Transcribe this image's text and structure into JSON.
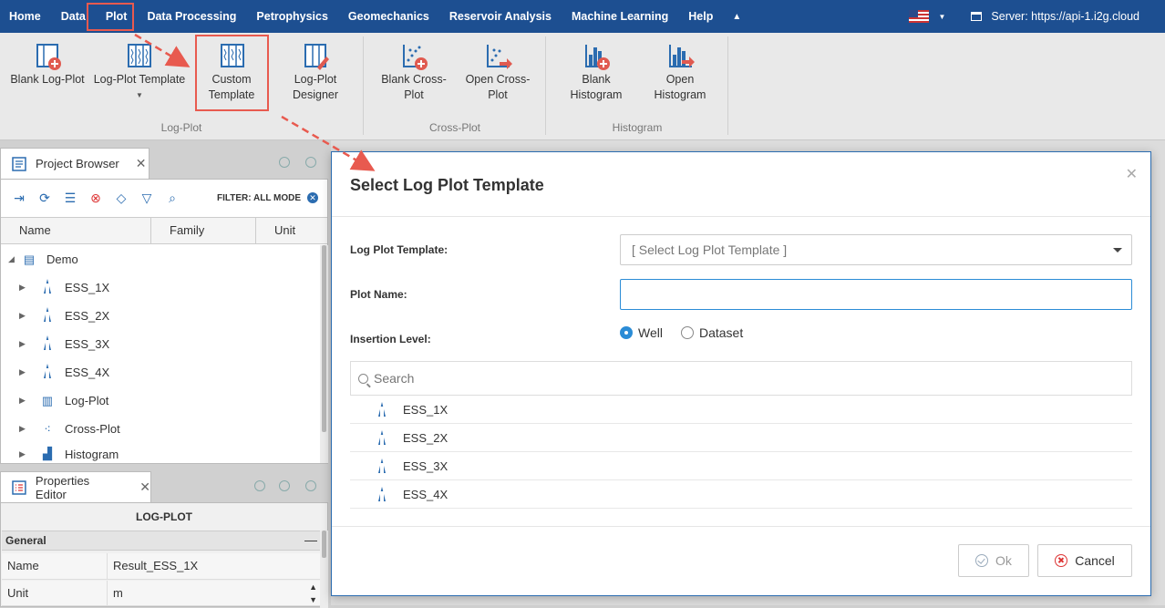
{
  "menu": {
    "items": [
      "Home",
      "Data",
      "Plot",
      "Data Processing",
      "Petrophysics",
      "Geomechanics",
      "Reservoir Analysis",
      "Machine Learning",
      "Help"
    ],
    "server_label": "Server: https://api-1.i2g.cloud"
  },
  "ribbon": {
    "blank_logplot": "Blank Log-Plot",
    "logplot_template": "Log-Plot Template",
    "custom_template_1": "Custom",
    "custom_template_2": "Template",
    "logplot_designer_1": "Log-Plot",
    "logplot_designer_2": "Designer",
    "blank_crossplot_1": "Blank Cross-",
    "blank_crossplot_2": "Plot",
    "open_crossplot_1": "Open Cross-",
    "open_crossplot_2": "Plot",
    "blank_histogram_1": "Blank",
    "blank_histogram_2": "Histogram",
    "open_histogram_1": "Open",
    "open_histogram_2": "Histogram",
    "group_logplot": "Log-Plot",
    "group_crossplot": "Cross-Plot",
    "group_histogram": "Histogram"
  },
  "project_browser": {
    "tab_label": "Project Browser",
    "filter_label": "FILTER: ALL MODE",
    "columns": [
      "Name",
      "Family",
      "Unit"
    ],
    "root": "Demo",
    "items": [
      {
        "label": "ESS_1X",
        "icon": "well-icon"
      },
      {
        "label": "ESS_2X",
        "icon": "well-icon"
      },
      {
        "label": "ESS_3X",
        "icon": "well-icon"
      },
      {
        "label": "ESS_4X",
        "icon": "well-icon"
      },
      {
        "label": "Log-Plot",
        "icon": "logplot-icon"
      },
      {
        "label": "Cross-Plot",
        "icon": "crossplot-icon"
      },
      {
        "label": "Histogram",
        "icon": "histogram-icon"
      }
    ]
  },
  "properties_editor": {
    "tab_label": "Properties Editor",
    "header": "LOG-PLOT",
    "section": "General",
    "rows": [
      {
        "key": "Name",
        "value": "Result_ESS_1X"
      },
      {
        "key": "Unit",
        "value": "m"
      }
    ]
  },
  "dialog": {
    "title": "Select Log Plot Template",
    "template_label": "Log Plot Template:",
    "template_placeholder": "[ Select Log Plot Template ]",
    "plot_name_label": "Plot Name:",
    "plot_name_value": "",
    "insertion_label": "Insertion Level:",
    "radio_well": "Well",
    "radio_dataset": "Dataset",
    "search_placeholder": "Search",
    "wells": [
      "ESS_1X",
      "ESS_2X",
      "ESS_3X",
      "ESS_4X"
    ],
    "ok_label": "Ok",
    "cancel_label": "Cancel"
  },
  "colors": {
    "menubar": "#1d4f91",
    "accent": "#2b8cd6",
    "annotation": "#e85a4f"
  }
}
